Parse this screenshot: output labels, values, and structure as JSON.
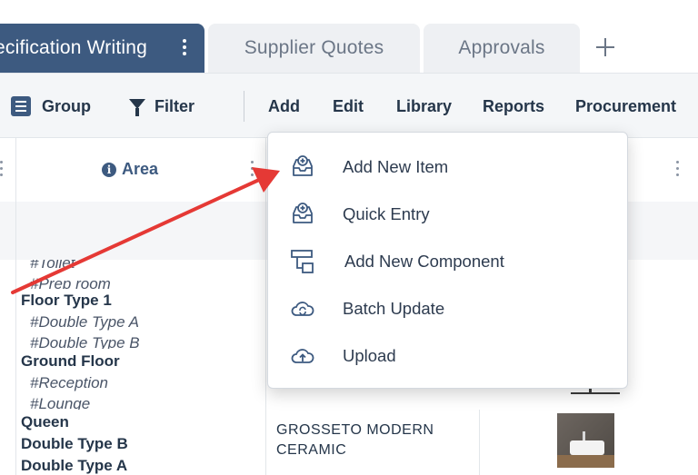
{
  "tabs": [
    {
      "label": "ecification Writing",
      "active": true
    },
    {
      "label": "Supplier Quotes",
      "active": false
    },
    {
      "label": "Approvals",
      "active": false
    }
  ],
  "add_tab_icon": "plus-icon",
  "toolbar": {
    "group_label": "Group",
    "filter_label": "Filter",
    "add_label": "Add",
    "edit_label": "Edit",
    "library_label": "Library",
    "reports_label": "Reports",
    "procurement_label": "Procurement"
  },
  "grid": {
    "area_header": "Area",
    "rows": [
      {
        "title": "",
        "tags": [
          "#Toilet",
          "#Prep room"
        ]
      },
      {
        "title": "Floor Type 1",
        "tags": [
          "#Double Type A",
          "#Double Type B"
        ]
      },
      {
        "title": "Ground Floor",
        "tags": [
          "#Reception",
          "#Lounge"
        ]
      },
      {
        "title": "Queen",
        "tags": [
          "Double Type B",
          "Double Type A"
        ],
        "description": "GROSSETO MODERN CERAMIC"
      }
    ]
  },
  "dropdown": {
    "items": [
      {
        "label": "Add New Item",
        "icon": "inbox-add-icon"
      },
      {
        "label": "Quick Entry",
        "icon": "inbox-quick-icon"
      },
      {
        "label": "Add New Component",
        "icon": "component-icon"
      },
      {
        "label": "Batch Update",
        "icon": "cloud-sync-icon"
      },
      {
        "label": "Upload",
        "icon": "cloud-upload-icon"
      }
    ]
  },
  "colors": {
    "accent": "#3d5a80",
    "annotation_arrow": "#e53935"
  }
}
